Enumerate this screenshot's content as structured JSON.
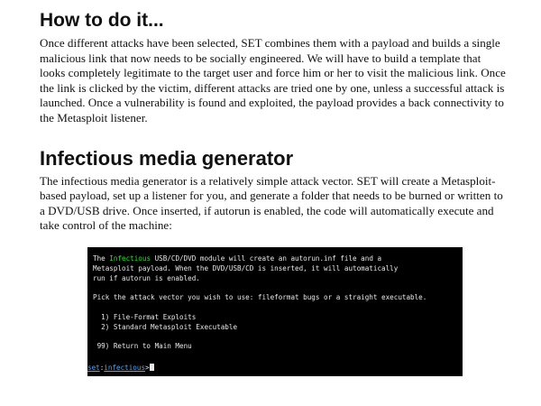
{
  "section1": {
    "heading": "How to do it...",
    "paragraph": "Once different attacks have been selected, SET combines them with a payload and builds a single malicious link that now needs to be socially engineered. We will have to build a template that looks completely legitimate to the target user and force him or her to visit the malicious link. Once the link is clicked by the victim, different attacks are tried one by one, unless a successful attack is launched. Once a vulnerability is found and exploited, the payload provides a back connectivity to the Metasploit listener."
  },
  "section2": {
    "heading": "Infectious media generator",
    "paragraph": "The infectious media generator is a relatively simple attack vector. SET will create a Metasploit-based payload, set up a listener for you, and generate a folder that needs to be burned or written to a DVD/USB drive. Once inserted, if autorun is enabled, the code will automatically execute and take control of the machine:"
  },
  "terminal": {
    "intro_prefix": "The ",
    "intro_highlight": "Infectious",
    "intro_rest": " USB/CD/DVD module will create an autorun.inf file and a",
    "line2": "Metasploit payload. When the DVD/USB/CD is inserted, it will automatically",
    "line3": "run if autorun is enabled.",
    "line4": "Pick the attack vector you wish to use: fileformat bugs or a straight executable.",
    "options": [
      "  1) File-Format Exploits",
      "  2) Standard Metasploit Executable"
    ],
    "return_option": " 99) Return to Main Menu",
    "prompt_set": "set",
    "prompt_sep": ":",
    "prompt_module": "infectious",
    "prompt_end": ">",
    "colors": {
      "background": "#000000",
      "highlight": "#2ee02e",
      "prompt": "#4aa8ff",
      "text": "#e8e8e8"
    }
  }
}
